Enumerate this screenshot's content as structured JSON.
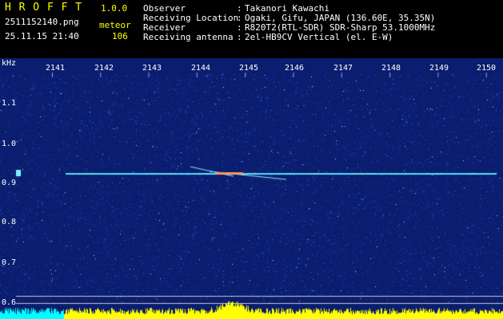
{
  "app": {
    "name": "H R O F F T",
    "version": "1.0.0",
    "file": "2511152140.png",
    "datetime": "25.11.15 21:40",
    "event_label": "meteor",
    "event_count": "106"
  },
  "info": [
    {
      "label": "Observer",
      "sep": ":",
      "value": "Takanori Kawachi"
    },
    {
      "label": "Receiving Location",
      "sep": ":",
      "value": "Ogaki, Gifu, JAPAN (136.60E, 35.35N)"
    },
    {
      "label": "Receiver",
      "sep": ":",
      "value": "R820T2(RTL-SDR) SDR-Sharp 53.1000MHz"
    },
    {
      "label": "Receiving antenna",
      "sep": ":",
      "value": "2el-HB9CV Vertical (el. E-W)"
    }
  ],
  "axis": {
    "y_unit": "kHz",
    "y_ticks": [
      "1.1",
      "1.0",
      "0.9",
      "0.8",
      "0.7",
      "0.6"
    ],
    "x_ticks": [
      "2141",
      "2142",
      "2143",
      "2144",
      "2145",
      "2146",
      "2147",
      "2148",
      "2149",
      "2150"
    ]
  },
  "colors": {
    "background": "#000000",
    "spectrogram": "#0a1d6e",
    "trace": "#4de0ff",
    "header_title": "#ffff00",
    "header_text": "#ffffff",
    "bar": "#ffff00",
    "bar_left": "#00ffff"
  }
}
